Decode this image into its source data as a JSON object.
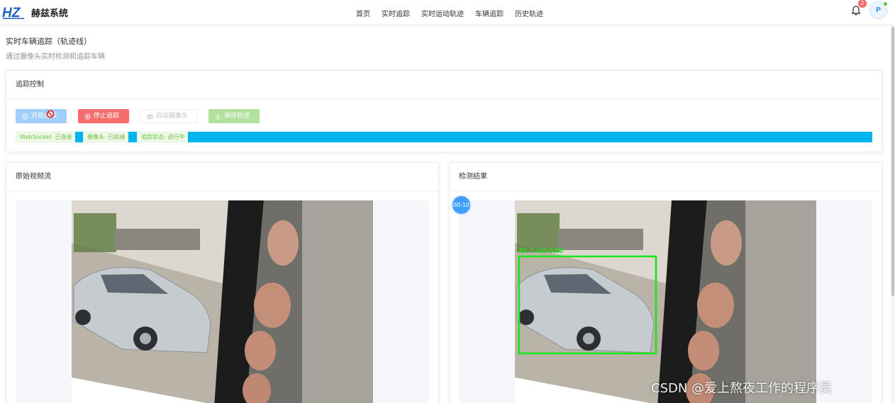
{
  "app": {
    "brand": "赫兹系统",
    "logo_text": "HZ"
  },
  "nav": {
    "items": [
      "首页",
      "实时追踪",
      "实时运动轨迹",
      "车辆追踪",
      "历史轨迹"
    ]
  },
  "header": {
    "notification_count": "2",
    "avatar_initial": "P"
  },
  "page": {
    "title": "实时车辆追踪（轨迹线）",
    "subtitle": "通过摄像头实时检测和追踪车辆"
  },
  "control": {
    "title": "追踪控制",
    "buttons": {
      "start": "开始追踪",
      "stop": "停止追踪",
      "camera": "启动摄像头",
      "save": "保存轨迹"
    },
    "status": {
      "websocket": "WebSocket: 已连接",
      "camera": "摄像头: 已就绪",
      "tracking": "追踪状态: 进行中"
    }
  },
  "panels": {
    "left_title": "原始视频流",
    "right_title": "检测结果",
    "timer": "00:10",
    "detection_label": "ID: 1  car  0.93"
  },
  "watermark": "CSDN @爱上熬夜工作的程序员",
  "colors": {
    "primary": "#409eff",
    "danger": "#f56c6c",
    "success": "#67c23a",
    "status_bar": "#00b4f0",
    "bbox": "#19e619"
  }
}
